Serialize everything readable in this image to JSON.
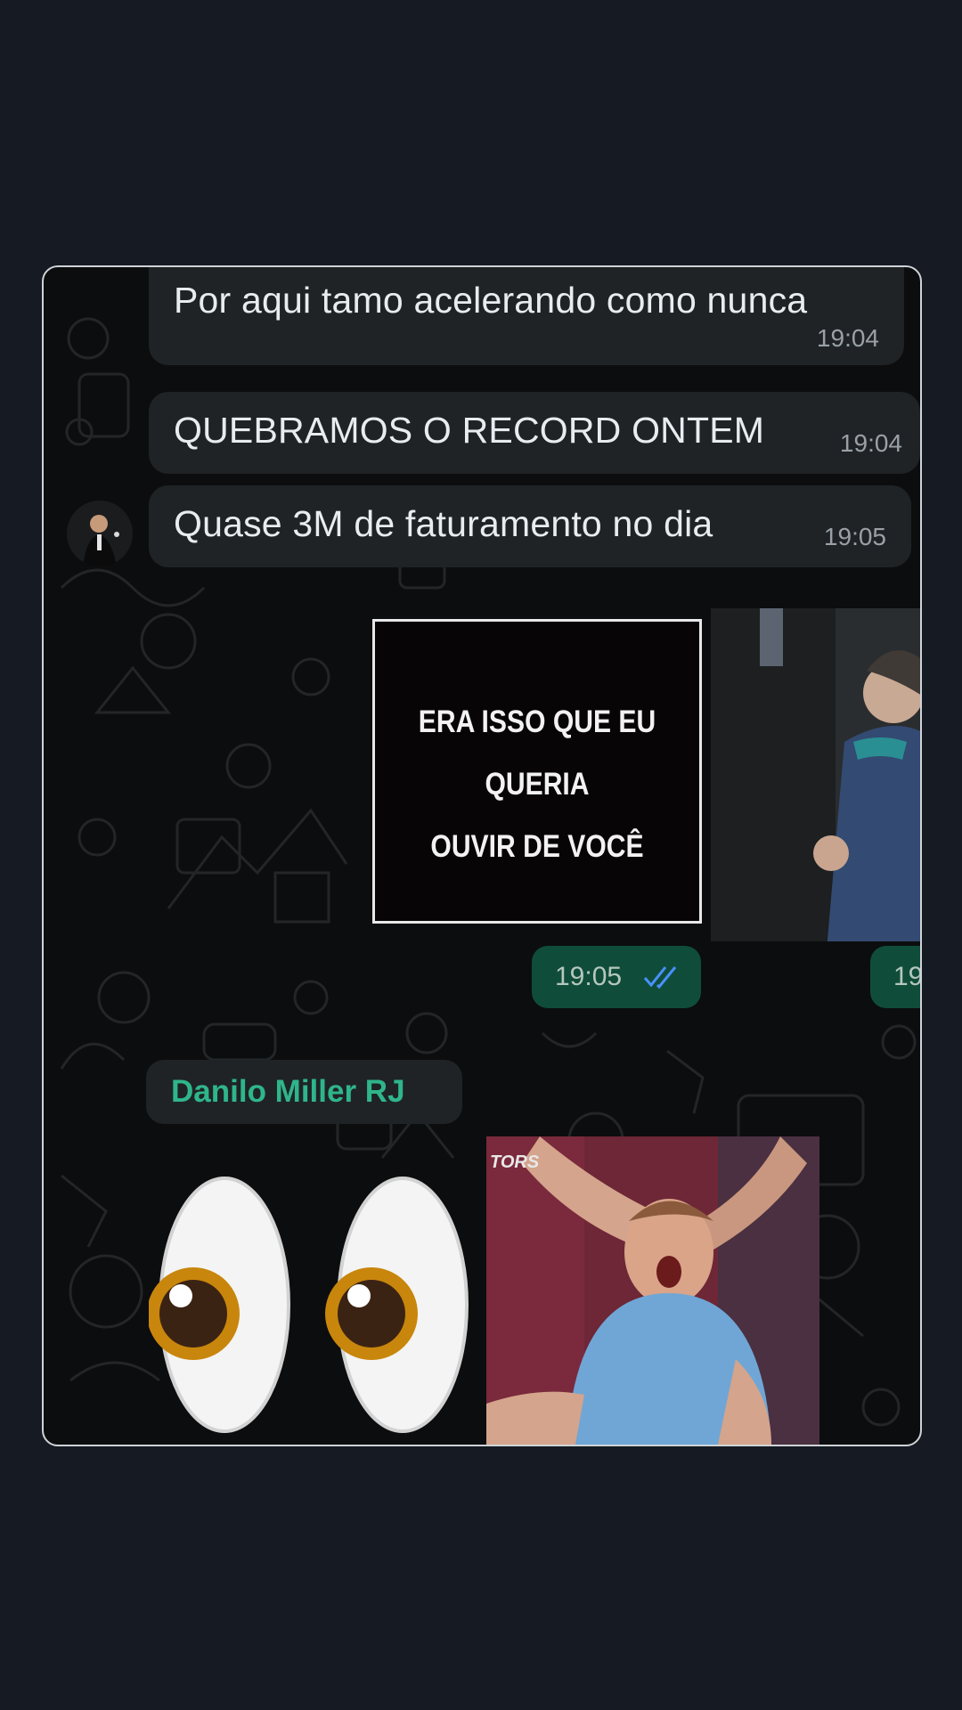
{
  "messages": [
    {
      "text": "Por aqui tamo acelerando como nunca",
      "time": "19:04"
    },
    {
      "text": "QUEBRAMOS O RECORD ONTEM",
      "time": "19:04"
    },
    {
      "text": "Quase 3M de faturamento no dia",
      "time": "19:05"
    }
  ],
  "sticker": {
    "lines": [
      "ERA ISSO QUE EU",
      "QUERIA",
      "OUVIR DE VOCÊ"
    ]
  },
  "outgoing": {
    "time": "19:05",
    "second_time_partial": "19",
    "status_icon": "double-check-icon",
    "read_color": "#4a90ff"
  },
  "sender": {
    "name": "Danilo Miller RJ",
    "name_color": "#2fb58a"
  },
  "gif_overlay_text": "TORS",
  "emoji": "eyes-emoji"
}
